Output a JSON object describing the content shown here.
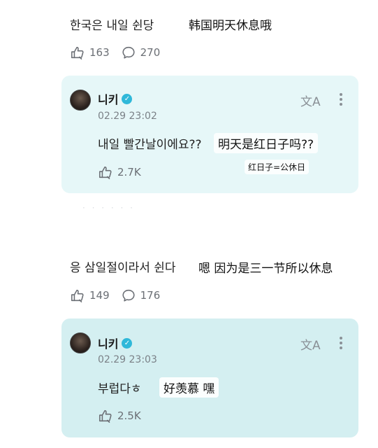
{
  "comments": [
    {
      "text": "한국은 내일 쉰당",
      "translation": "韩国明天休息哦",
      "likes": "163",
      "replies": "270",
      "reply": {
        "username": "니키",
        "timestamp": "02.29 23:02",
        "text": "내일 빨간날이에요??",
        "translation": "明天是红日子吗??",
        "note": "红日子=公休日",
        "likes": "2.7K"
      }
    },
    {
      "text": "응 삼일절이라서 쉰다",
      "translation": "嗯 因为是三一节所以休息",
      "likes": "149",
      "replies": "176",
      "reply": {
        "username": "니키",
        "timestamp": "02.29 23:03",
        "text": "부럽다ㅎ",
        "translation": "好羡慕 嘿",
        "likes": "2.5K"
      }
    }
  ],
  "icons": {
    "like": "like-icon",
    "comment": "comment-icon",
    "translate": "translate-icon",
    "more": "more-icon",
    "verified": "verified-badge-icon"
  },
  "colors": {
    "card_light": "#e6f7f8",
    "card_teal": "#d4eff1",
    "verified": "#2fb8d9",
    "muted_text": "#6b6f75"
  }
}
